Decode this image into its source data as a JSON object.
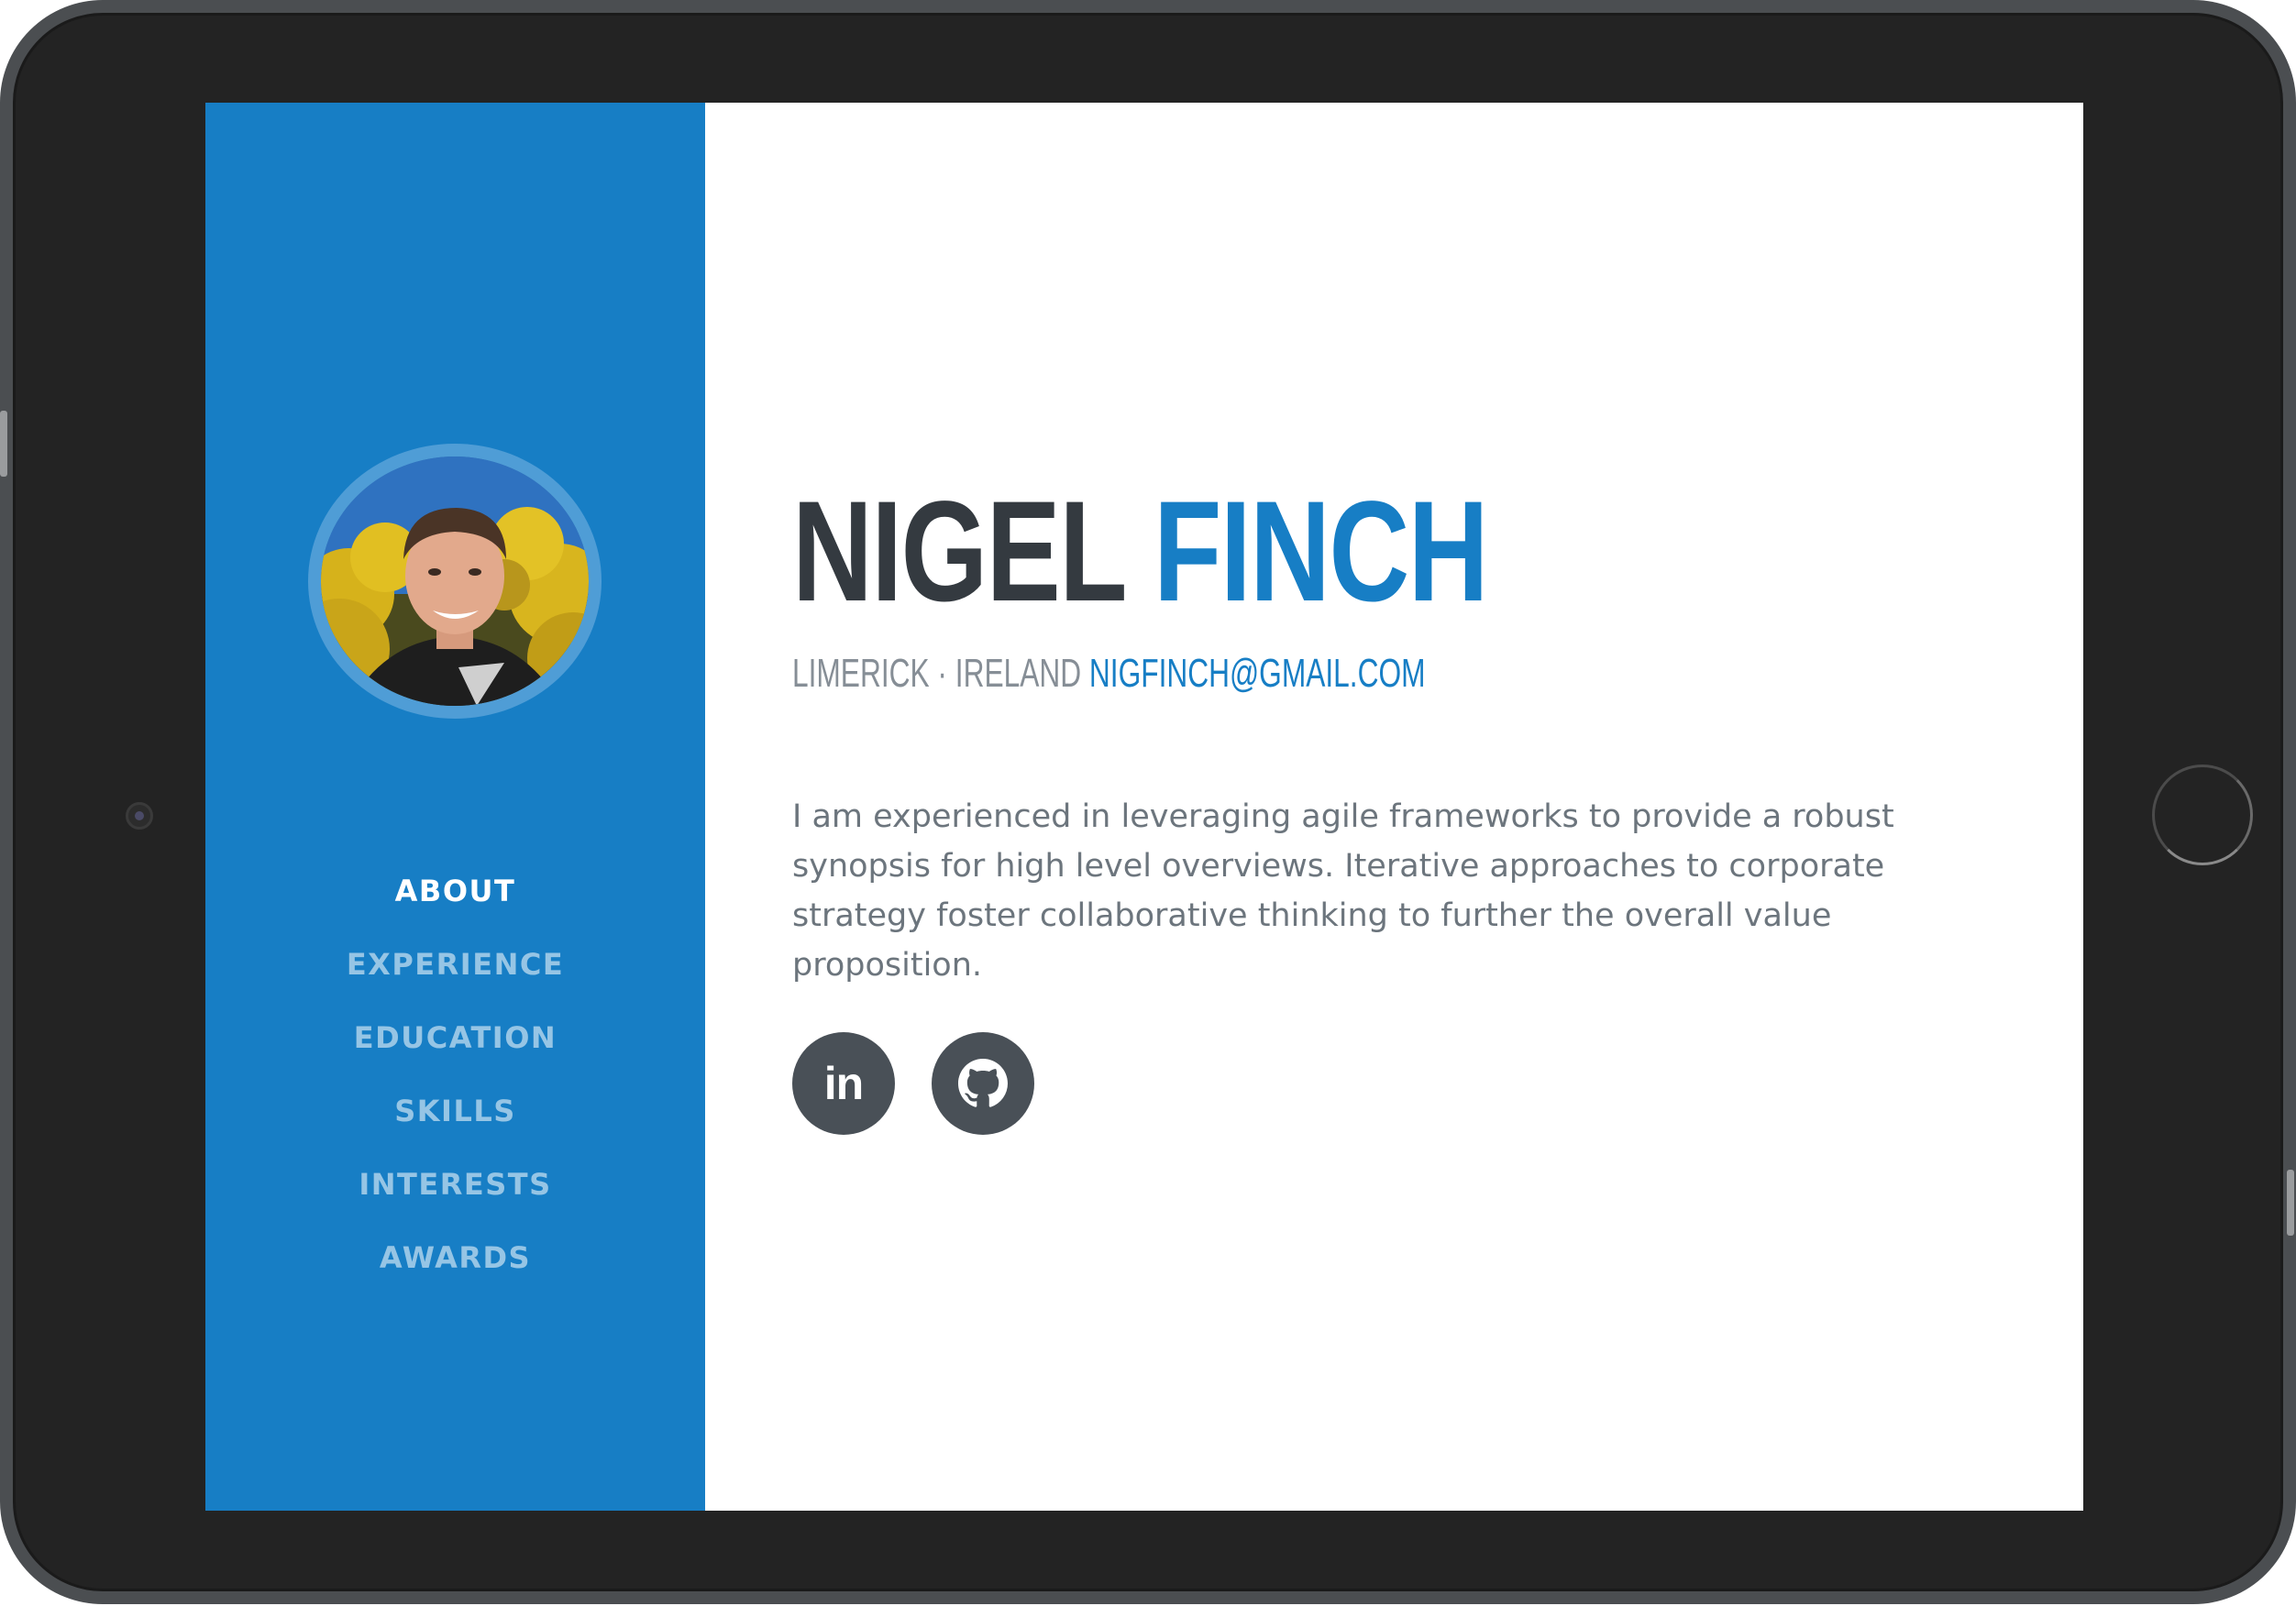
{
  "profile": {
    "first_name": "NIGEL",
    "last_name": "FINCH",
    "location": "LIMERICK · IRELAND",
    "email": "NIGFINCH@GMAIL.COM",
    "bio": "I am experienced in leveraging agile frameworks to provide a robust synopsis for high level overviews. Iterative approaches to corporate strategy foster collaborative thinking to further the overall value proposition."
  },
  "nav": {
    "items": [
      {
        "label": "ABOUT",
        "active": true
      },
      {
        "label": "EXPERIENCE",
        "active": false
      },
      {
        "label": "EDUCATION",
        "active": false
      },
      {
        "label": "SKILLS",
        "active": false
      },
      {
        "label": "INTERESTS",
        "active": false
      },
      {
        "label": "AWARDS",
        "active": false
      }
    ]
  },
  "social": {
    "linkedin_icon": "linkedin-icon",
    "linkedin_text": "in",
    "github_icon": "github-icon"
  },
  "colors": {
    "primary": "#177ec5",
    "dark": "#343a40",
    "muted": "#868e96",
    "social_bg": "#495057"
  }
}
